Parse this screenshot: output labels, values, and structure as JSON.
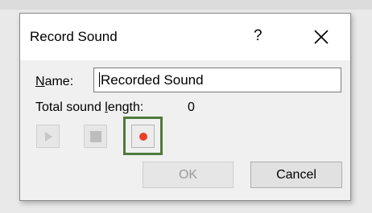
{
  "dialog": {
    "title": "Record Sound",
    "help_label": "?",
    "close_icon": "close-icon"
  },
  "name": {
    "label_accel": "N",
    "label_rest": "ame:",
    "value": "Recorded Sound"
  },
  "length": {
    "label_pre": "Total sound ",
    "label_accel": "l",
    "label_post": "ength:",
    "value": "0"
  },
  "controls": {
    "play_icon": "play-icon",
    "stop_icon": "stop-icon",
    "record_icon": "record-icon",
    "record_color": "#e8412c"
  },
  "buttons": {
    "ok": "OK",
    "cancel": "Cancel"
  },
  "colors": {
    "highlight": "#4f7a3d"
  }
}
